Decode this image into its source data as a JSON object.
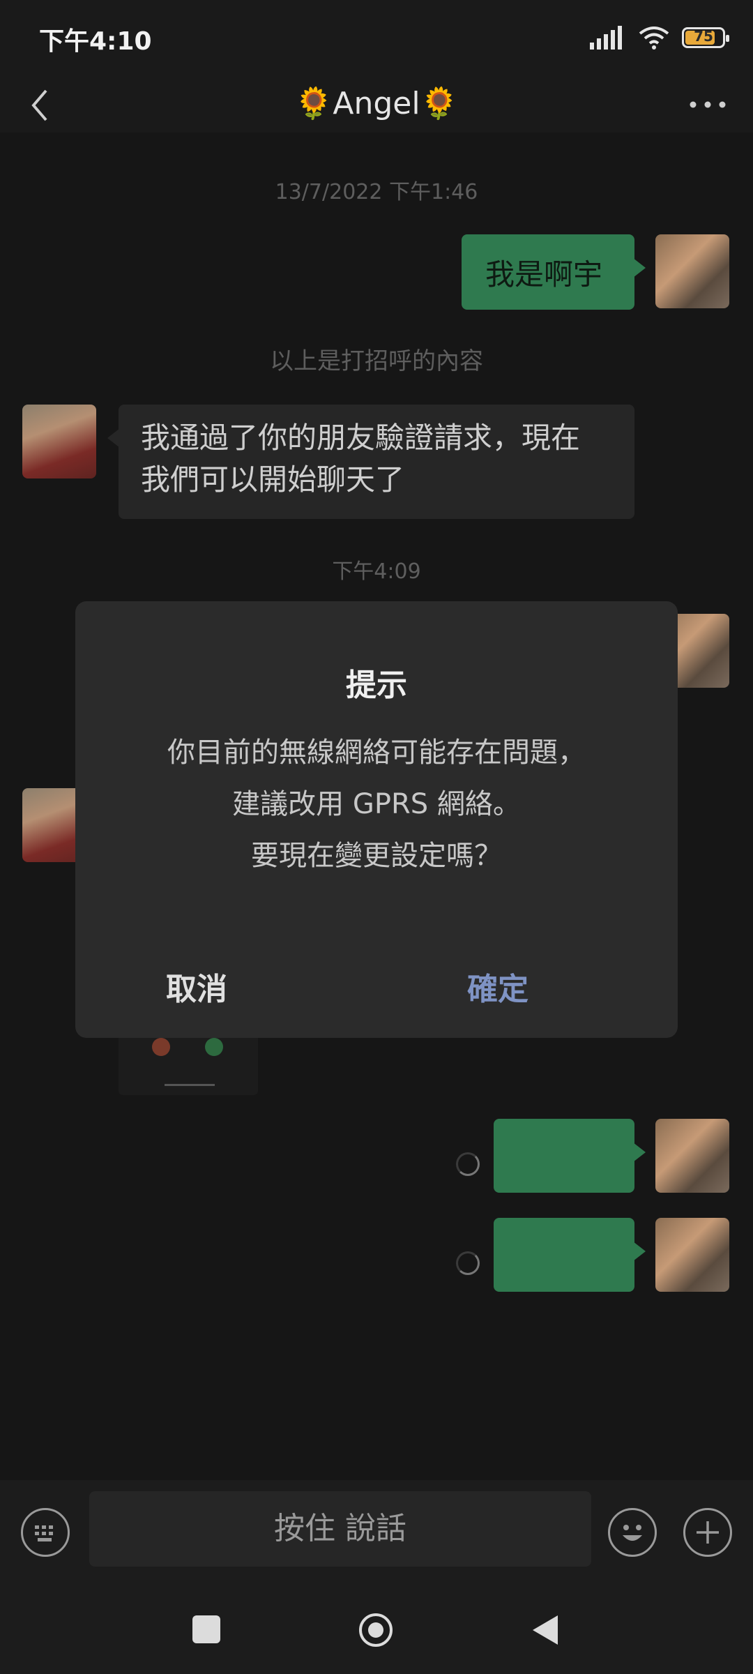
{
  "status": {
    "time": "下午4:10",
    "battery": "75"
  },
  "header": {
    "title": "🌻Angel🌻"
  },
  "chat": {
    "ts1": "13/7/2022 下午1:46",
    "msg_me_1": "我是啊宇",
    "system_note": "以上是打招呼的內容",
    "msg_her_1_line1": "我通過了你的朋友驗證請求，現在",
    "msg_her_1_line2": "我們可以開始聊天了",
    "ts2": "下午4:09"
  },
  "dialog": {
    "title": "提示",
    "line1": "你目前的無線網絡可能存在問題，",
    "line2": "建議改用 GPRS 網絡。",
    "line3": "要現在變更設定嗎？",
    "cancel": "取消",
    "confirm": "確定"
  },
  "input": {
    "hold_to_talk": "按住 說話"
  },
  "colors": {
    "bubble_me": "#2f7a4f",
    "confirm": "#7f93c4",
    "cancel": "#e0e0e0"
  }
}
